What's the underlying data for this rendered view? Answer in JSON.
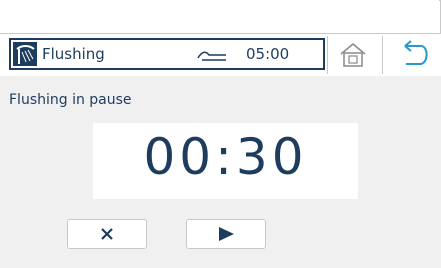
{
  "header": {
    "mode_label": "Flushing",
    "mode_icon": "shower-flushing-icon",
    "flow_icon": "water-flow-icon",
    "duration": "05:00",
    "home_icon": "home-icon",
    "back_icon": "back-arrow-icon"
  },
  "panel": {
    "status_text": "Flushing in pause",
    "timer_value": "00:30"
  },
  "controls": {
    "cancel_icon": "close-icon",
    "play_icon": "play-icon"
  },
  "colors": {
    "primary": "#1d3c5e",
    "panel_bg": "#f0f0f0",
    "border": "#c9c9c9"
  }
}
